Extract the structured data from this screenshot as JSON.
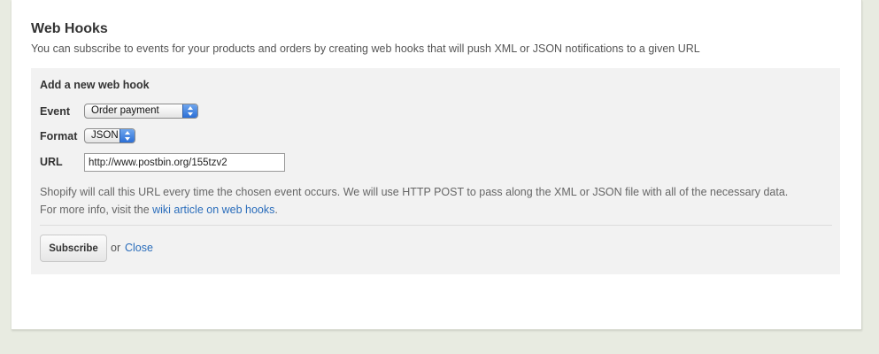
{
  "section": {
    "title": "Web Hooks",
    "description": "You can subscribe to events for your products and orders by creating web hooks that will push XML or JSON notifications to a given URL"
  },
  "form": {
    "heading": "Add a new web hook",
    "event": {
      "label": "Event",
      "selected": "Order payment"
    },
    "format": {
      "label": "Format",
      "selected": "JSON"
    },
    "url": {
      "label": "URL",
      "value": "http://www.postbin.org/155tzv2"
    },
    "help_line1": "Shopify will call this URL every time the chosen event occurs. We will use HTTP POST to pass along the XML or JSON file with all of the necessary data.",
    "help_line2_prefix": "For more info, visit the ",
    "help_link": "wiki article on web hooks",
    "help_line2_suffix": ".",
    "subscribe_label": "Subscribe",
    "or_text": "or",
    "close_label": "Close"
  },
  "colors": {
    "page_bg": "#e8ebe1",
    "panel_bg": "#f2f2f2",
    "link": "#2a6dbb"
  }
}
